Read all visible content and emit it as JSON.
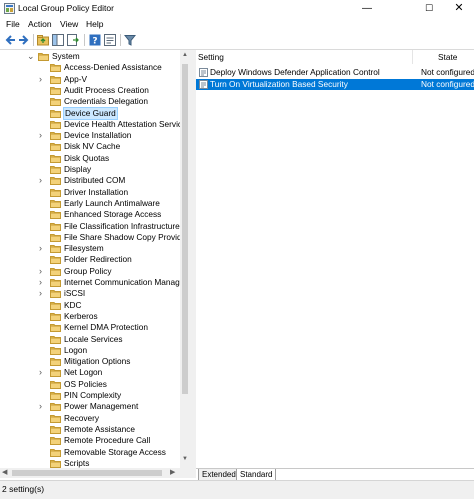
{
  "window": {
    "title": "Local Group Policy Editor",
    "min_glyph": "—",
    "max_glyph": "☐",
    "close_glyph": "✕"
  },
  "menu": [
    "File",
    "Action",
    "View",
    "Help"
  ],
  "toolbar": [
    "back-icon",
    "forward-icon",
    "up-folder-icon",
    "show-hide-tree-icon",
    "export-list-icon",
    "help-icon",
    "properties-icon",
    "filter-icon"
  ],
  "tree": {
    "parent": "System",
    "items": [
      {
        "label": "Access-Denied Assistance",
        "expandable": false
      },
      {
        "label": "App-V",
        "expandable": true
      },
      {
        "label": "Audit Process Creation",
        "expandable": false
      },
      {
        "label": "Credentials Delegation",
        "expandable": false
      },
      {
        "label": "Device Guard",
        "expandable": false,
        "selected": true
      },
      {
        "label": "Device Health Attestation Service",
        "expandable": false
      },
      {
        "label": "Device Installation",
        "expandable": true
      },
      {
        "label": "Disk NV Cache",
        "expandable": false
      },
      {
        "label": "Disk Quotas",
        "expandable": false
      },
      {
        "label": "Display",
        "expandable": false
      },
      {
        "label": "Distributed COM",
        "expandable": true
      },
      {
        "label": "Driver Installation",
        "expandable": false
      },
      {
        "label": "Early Launch Antimalware",
        "expandable": false
      },
      {
        "label": "Enhanced Storage Access",
        "expandable": false
      },
      {
        "label": "File Classification Infrastructure",
        "expandable": false
      },
      {
        "label": "File Share Shadow Copy Provider",
        "expandable": false
      },
      {
        "label": "Filesystem",
        "expandable": true
      },
      {
        "label": "Folder Redirection",
        "expandable": false
      },
      {
        "label": "Group Policy",
        "expandable": true
      },
      {
        "label": "Internet Communication Managem",
        "expandable": true
      },
      {
        "label": "iSCSI",
        "expandable": true
      },
      {
        "label": "KDC",
        "expandable": false
      },
      {
        "label": "Kerberos",
        "expandable": false
      },
      {
        "label": "Kernel DMA Protection",
        "expandable": false
      },
      {
        "label": "Locale Services",
        "expandable": false
      },
      {
        "label": "Logon",
        "expandable": false
      },
      {
        "label": "Mitigation Options",
        "expandable": false
      },
      {
        "label": "Net Logon",
        "expandable": true
      },
      {
        "label": "OS Policies",
        "expandable": false
      },
      {
        "label": "PIN Complexity",
        "expandable": false
      },
      {
        "label": "Power Management",
        "expandable": true
      },
      {
        "label": "Recovery",
        "expandable": false
      },
      {
        "label": "Remote Assistance",
        "expandable": false
      },
      {
        "label": "Remote Procedure Call",
        "expandable": false
      },
      {
        "label": "Removable Storage Access",
        "expandable": false
      },
      {
        "label": "Scripts",
        "expandable": false
      }
    ]
  },
  "list": {
    "columns": {
      "setting": "Setting",
      "state": "State"
    },
    "rows": [
      {
        "name": "Deploy Windows Defender Application Control",
        "state": "Not configured",
        "selected": false
      },
      {
        "name": "Turn On Virtualization Based Security",
        "state": "Not configured",
        "selected": true
      }
    ]
  },
  "tabs": [
    "Extended",
    "Standard"
  ],
  "status": "2 setting(s)",
  "colors": {
    "selection_blue": "#0078d7",
    "tree_selection": "#cce8ff",
    "folder": "#e8c15a"
  }
}
